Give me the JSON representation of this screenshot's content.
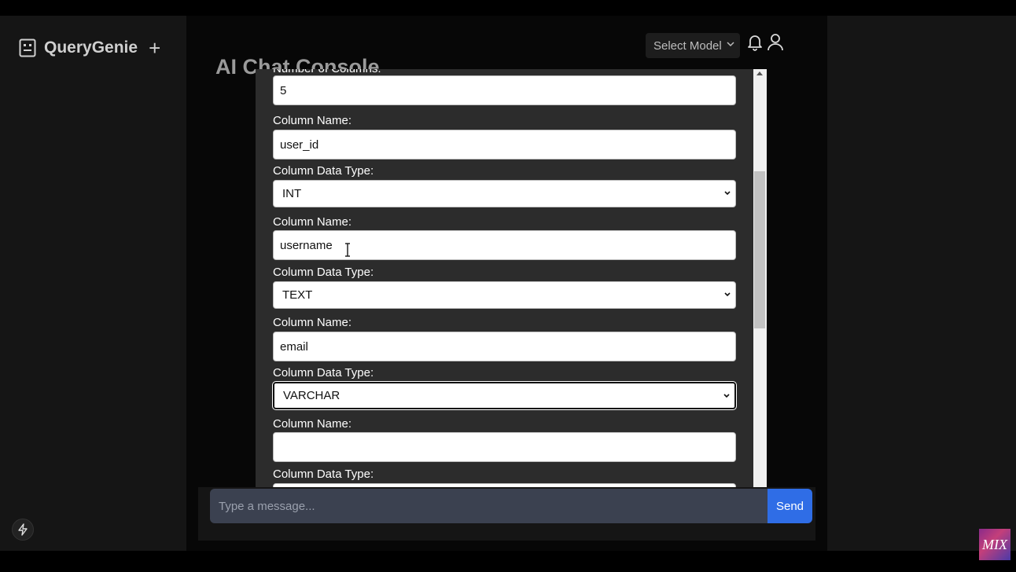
{
  "app": {
    "brand_name": "QueryGenie",
    "page_title": "AI Chat Console",
    "model_select_label": "Select Model"
  },
  "modal": {
    "partial_top_label": "Number of Columns:",
    "number_of_columns_value": "5",
    "fields": [
      {
        "name_label": "Column Name:",
        "name_value": "user_id",
        "type_label": "Column Data Type:",
        "type_value": "INT"
      },
      {
        "name_label": "Column Name:",
        "name_value": "username",
        "type_label": "Column Data Type:",
        "type_value": "TEXT"
      },
      {
        "name_label": "Column Name:",
        "name_value": "email",
        "type_label": "Column Data Type:",
        "type_value": "VARCHAR"
      },
      {
        "name_label": "Column Name:",
        "name_value": "",
        "type_label": "Column Data Type:",
        "type_value": ""
      }
    ]
  },
  "chat": {
    "input_placeholder": "Type a message...",
    "send_label": "Send"
  },
  "watermark": "MIX",
  "colors": {
    "send_button": "#2f6de6",
    "chat_input_bg": "#3b4150",
    "modal_bg": "#2c2c2c"
  }
}
